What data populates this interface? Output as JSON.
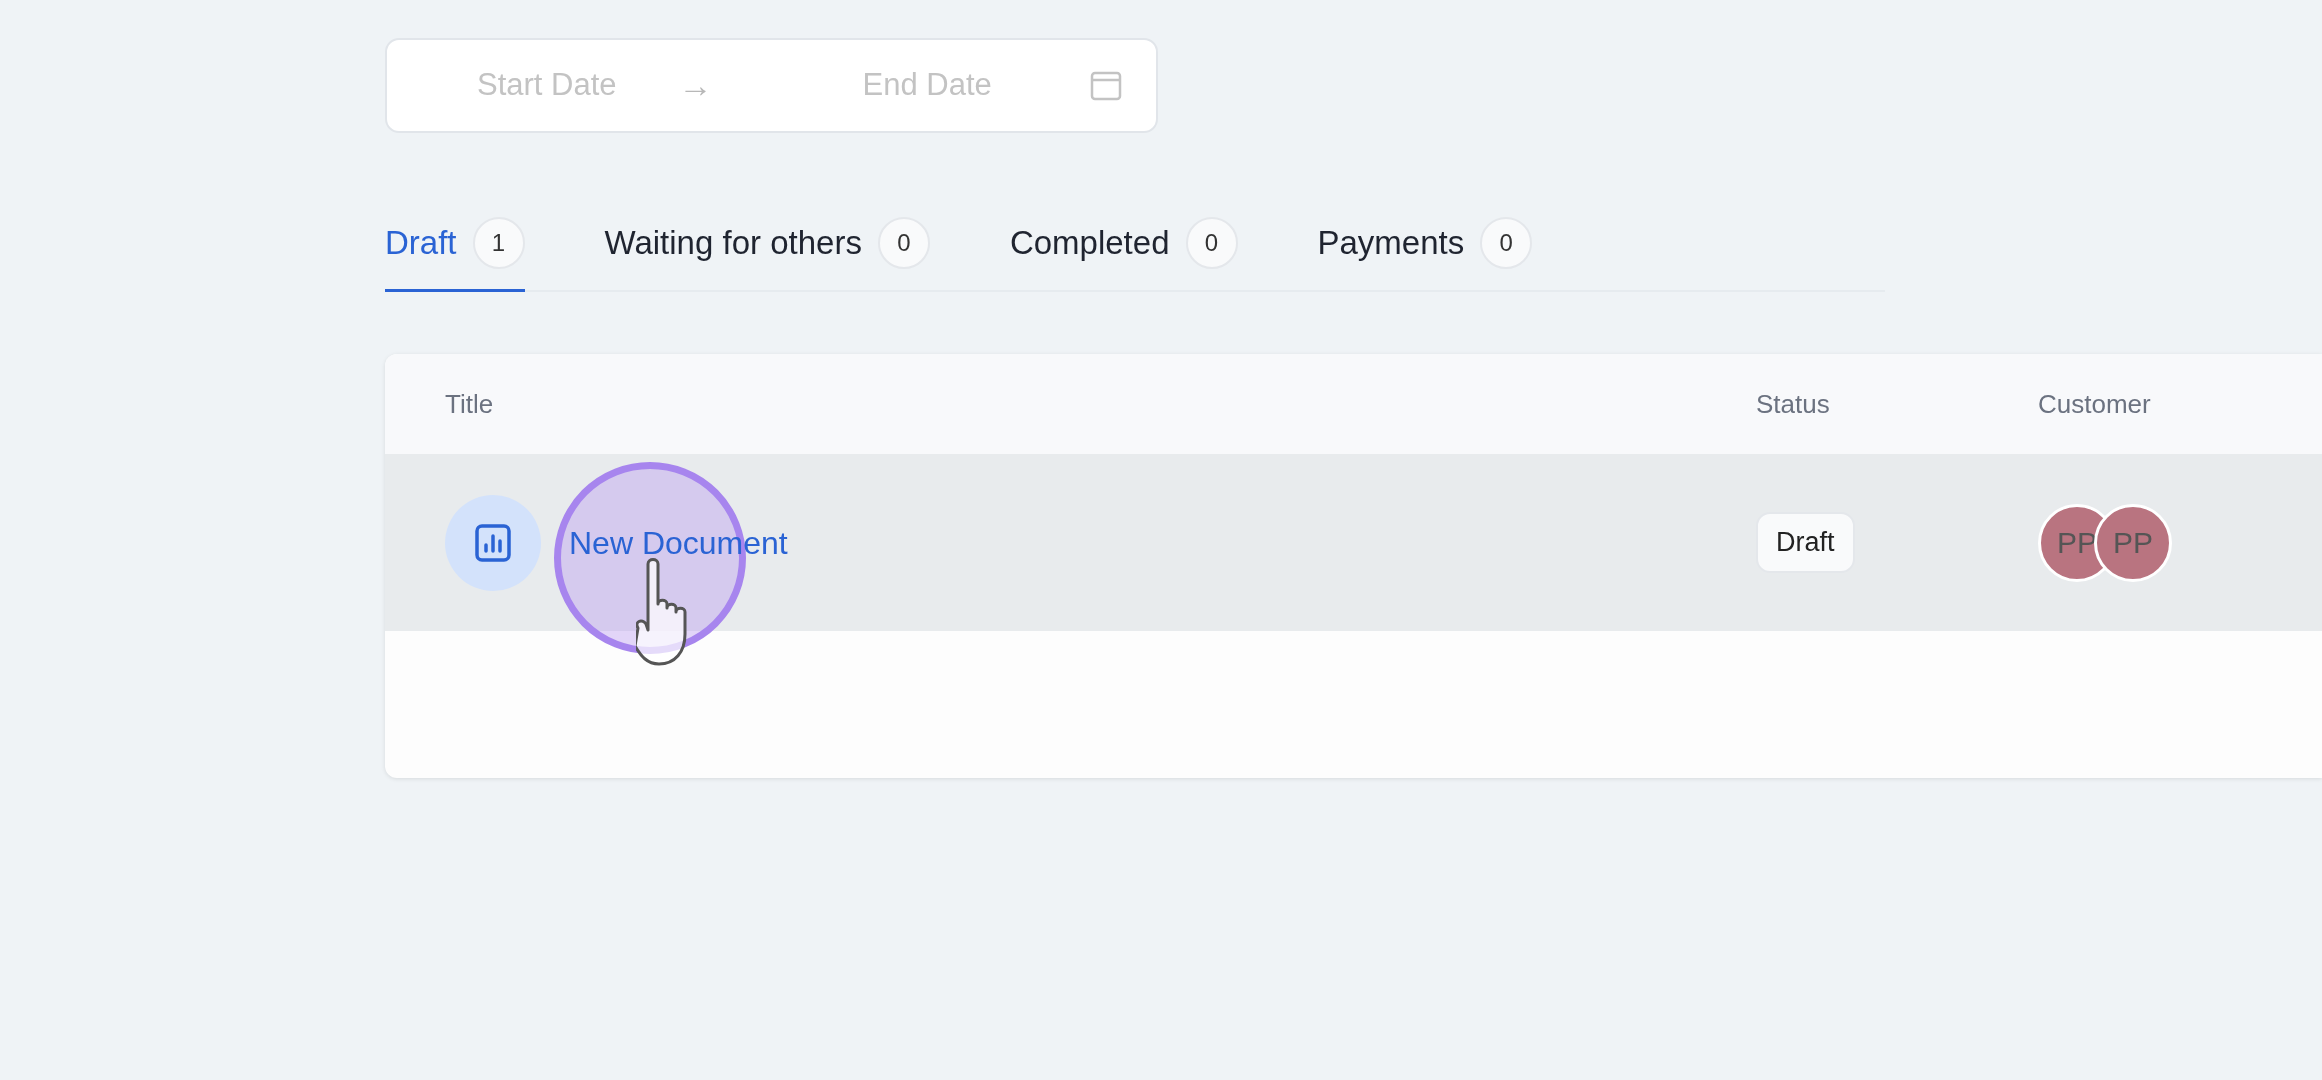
{
  "date_range": {
    "start_placeholder": "Start Date",
    "separator": "→",
    "end_placeholder": "End Date"
  },
  "tabs": [
    {
      "label": "Draft",
      "count": "1",
      "selected": true
    },
    {
      "label": "Waiting for others",
      "count": "0",
      "selected": false
    },
    {
      "label": "Completed",
      "count": "0",
      "selected": false
    },
    {
      "label": "Payments",
      "count": "0",
      "selected": false
    }
  ],
  "table": {
    "columns": [
      "Title",
      "Status",
      "Customer"
    ],
    "rows": [
      {
        "title": "New Document",
        "status": "Draft",
        "customers": [
          "PP",
          "PP"
        ],
        "hovered": true
      }
    ]
  }
}
